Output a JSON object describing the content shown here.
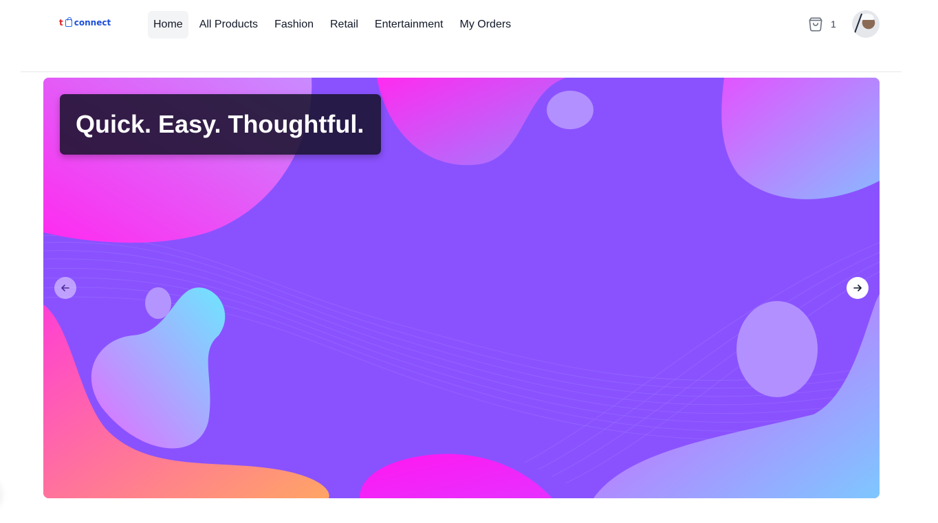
{
  "brand": {
    "logo_prefix": "t",
    "logo_word": "connect",
    "logo_icon": "shopping-bag-icon"
  },
  "nav": {
    "items": [
      {
        "label": "Home",
        "active": true
      },
      {
        "label": "All Products",
        "active": false
      },
      {
        "label": "Fashion",
        "active": false
      },
      {
        "label": "Retail",
        "active": false
      },
      {
        "label": "Entertainment",
        "active": false
      },
      {
        "label": "My Orders",
        "active": false
      }
    ]
  },
  "cart": {
    "icon": "shopping-bag-icon",
    "count": "1"
  },
  "user": {
    "avatar": "user-avatar"
  },
  "hero": {
    "headline": "Quick. Easy. Thoughtful.",
    "prev_icon": "arrow-left-icon",
    "next_icon": "arrow-right-icon",
    "colors": {
      "background": "#8a52ff",
      "pink": "#ff2af0",
      "cyan": "#6de6ff",
      "orange": "#ff9a62",
      "lilac": "#b89bff"
    }
  }
}
